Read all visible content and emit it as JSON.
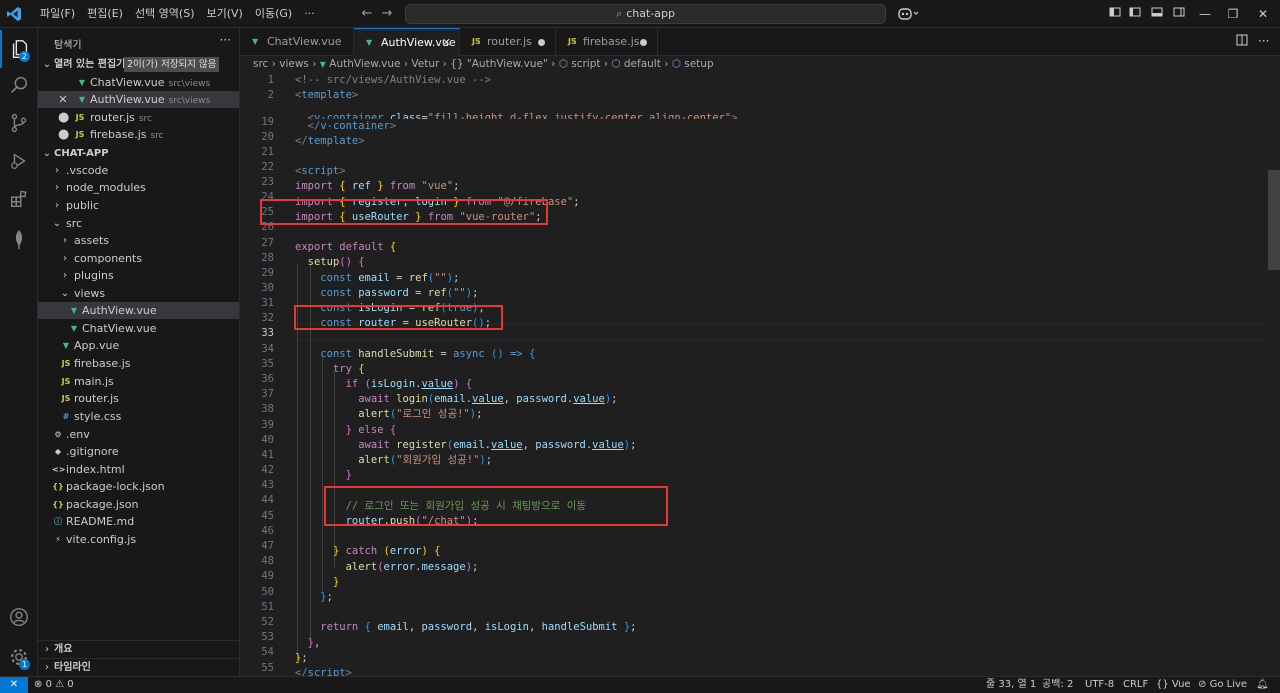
{
  "titlebar": {
    "menu": [
      "파일(F)",
      "편집(E)",
      "선택 영역(S)",
      "보기(V)",
      "이동(G)",
      "···"
    ],
    "search_text": "chat-app"
  },
  "activity": {
    "explorer_badge": "2",
    "accounts_label": "",
    "manage_badge": "1"
  },
  "sidebar": {
    "title": "탐색기",
    "open_editors_header": "열려 있는 편집기",
    "unsaved_badge": "2이(가) 저장되지 않음",
    "open_editors": [
      {
        "name": "ChatView.vue",
        "desc": "src\\views",
        "icon": "vue"
      },
      {
        "name": "AuthView.vue",
        "desc": "src\\views",
        "icon": "vue"
      },
      {
        "name": "router.js",
        "desc": "src",
        "icon": "js"
      },
      {
        "name": "firebase.js",
        "desc": "src",
        "icon": "js"
      }
    ],
    "project_header": "CHAT-APP",
    "tree": [
      {
        "name": ".vscode",
        "type": "folder"
      },
      {
        "name": "node_modules",
        "type": "folder"
      },
      {
        "name": "public",
        "type": "folder"
      },
      {
        "name": "src",
        "type": "folder-open"
      },
      {
        "name": "assets",
        "type": "folder"
      },
      {
        "name": "components",
        "type": "folder"
      },
      {
        "name": "plugins",
        "type": "folder"
      },
      {
        "name": "views",
        "type": "folder-open"
      },
      {
        "name": "AuthView.vue",
        "type": "vue"
      },
      {
        "name": "ChatView.vue",
        "type": "vue"
      },
      {
        "name": "App.vue",
        "type": "vue"
      },
      {
        "name": "firebase.js",
        "type": "js"
      },
      {
        "name": "main.js",
        "type": "js"
      },
      {
        "name": "router.js",
        "type": "js"
      },
      {
        "name": "style.css",
        "type": "css"
      },
      {
        "name": ".env",
        "type": "gear"
      },
      {
        "name": ".gitignore",
        "type": "git"
      },
      {
        "name": "index.html",
        "type": "html"
      },
      {
        "name": "package-lock.json",
        "type": "json"
      },
      {
        "name": "package.json",
        "type": "json"
      },
      {
        "name": "README.md",
        "type": "info"
      },
      {
        "name": "vite.config.js",
        "type": "vite"
      }
    ],
    "outline_header": "개요",
    "timeline_header": "타임라인"
  },
  "tabs": [
    {
      "label": "ChatView.vue",
      "icon": "V",
      "state": "normal"
    },
    {
      "label": "AuthView.vue",
      "icon": "V",
      "state": "active"
    },
    {
      "label": "router.js",
      "icon": "JS",
      "state": "dirty"
    },
    {
      "label": "firebase.js",
      "icon": "JS",
      "state": "dirty"
    }
  ],
  "breadcrumb": [
    "src",
    "views",
    "AuthView.vue",
    "Vetur",
    "{} \"AuthView.vue\"",
    "script",
    "default",
    "setup"
  ],
  "code": {
    "line_numbers": [
      "1",
      "2",
      "19",
      "20",
      "21",
      "22",
      "23",
      "24",
      "25",
      "26",
      "27",
      "28",
      "29",
      "30",
      "31",
      "32",
      "33",
      "34",
      "35",
      "36",
      "37",
      "38",
      "39",
      "40",
      "41",
      "42",
      "43",
      "44",
      "45",
      "46",
      "47",
      "48",
      "49",
      "50",
      "51",
      "52",
      "53",
      "54",
      "55"
    ],
    "current_line": "33"
  },
  "statusbar": {
    "errors": "0",
    "warnings": "0",
    "position": "줄 33, 열 1",
    "spaces": "공백: 2",
    "encoding": "UTF-8",
    "eol": "CRLF",
    "language": "Vue",
    "golive": "Go Live"
  }
}
